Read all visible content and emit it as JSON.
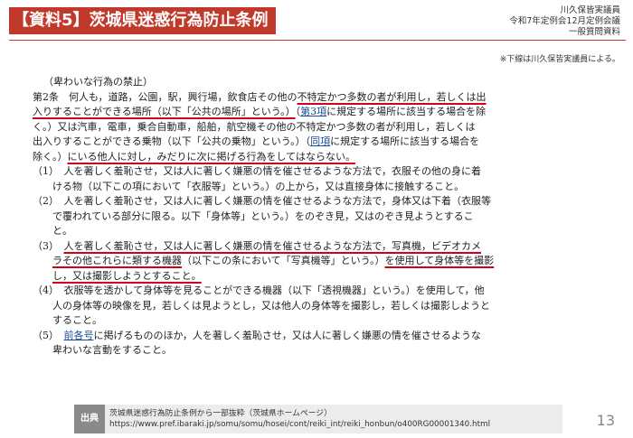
{
  "header": {
    "title": "【資料5】茨城県迷惑行為防止条例",
    "org_line1": "川久保皆実議員",
    "org_line2": "令和7年定例会12月定例会議",
    "org_line3": "一般質問資料"
  },
  "note": "※下線は川久保皆実議員による。",
  "doc": {
    "heading": "（卑わいな行為の禁止）",
    "lines": [
      {
        "a": "第2条　何人も，道路，公園，駅，興行場，飲食店その他の",
        "u": "不特定かつ多数の者が利用し，若しくは出"
      },
      {
        "u": "入りすることができる場所（以下「公共の場所」という。）",
        "a": "（",
        "l": "第3項",
        "b": "に規定する場所に該当する場合を除"
      },
      {
        "a": "く。）又は汽車，電車，乗合自動車，船舶，航空機その他の不特定かつ多数の者が利用し，若しくは"
      },
      {
        "a": "出入りすることができる乗物（以下「公共の乗物」という。）（",
        "l": "同項",
        "b": "に規定する場所に該当する場合を"
      },
      {
        "a": "除く。）",
        "u": "にいる他人に対し，みだりに次に掲げる行為をしてはならない。"
      },
      {
        "a": "（1）　人を著しく羞恥させ，又は人に著しく嫌悪の情を催させるような方法で，衣服その他の身に着"
      },
      {
        "a": "　　ける物（以下この項において「衣服等」という。）の上から，又は直接身体に接触すること。"
      },
      {
        "a": "（2）　人を著しく羞恥させ，又は人に著しく嫌悪の情を催させるような方法で，身体又は下着（衣服等"
      },
      {
        "a": "　　で覆われている部分に限る。以下「身体等」という。）をのぞき見，又はのぞき見ようとするこ"
      },
      {
        "a": "　　と。"
      },
      {
        "a": "（3）　",
        "u": "人を著しく羞恥させ，又は人に著しく嫌悪の情を催させるような方法で，写真機，ビデオカメ"
      },
      {
        "a": "　　",
        "u": "ラその他これらに類する機器",
        "b": "（以下この条において「写真機等」という。）",
        "u2": "を使用して身体等を撮影"
      },
      {
        "a": "　　",
        "u": "し，又は撮影しようとすること。"
      },
      {
        "a": "（4）　衣服等を透かして身体等を見ることができる機器（以下「透視機器」という。）を使用して，他"
      },
      {
        "a": "　　人の身体等の映像を見，若しくは見ようとし，又は他人の身体等を撮影し，若しくは撮影しようと"
      },
      {
        "a": "　　すること。"
      },
      {
        "a": "（5）　",
        "l": "前各号",
        "b": "に掲げるもののほか，人を著しく羞恥させ，又は人に著しく嫌悪の情を催させるような"
      },
      {
        "a": "　　卑わいな言動をすること。"
      }
    ]
  },
  "footer": {
    "label": "出典",
    "line1": "茨城県迷惑行為防止条例から一部抜粋（茨城県ホームページ）",
    "line2": "https://www.pref.ibaraki.jp/somu/somu/hosei/cont/reiki_int/reiki_honbun/o400RG00001340.html",
    "page": "13"
  }
}
